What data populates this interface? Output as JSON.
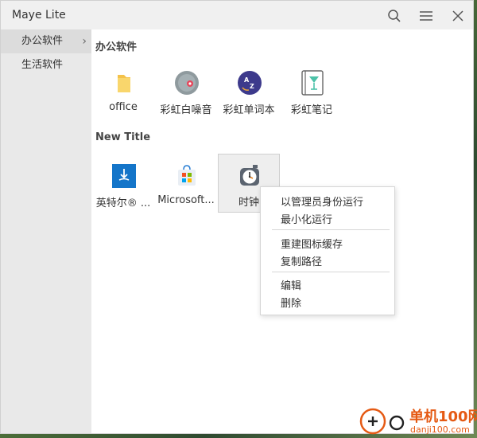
{
  "window": {
    "title": "Maye Lite"
  },
  "sidebar": {
    "items": [
      {
        "label": "办公软件",
        "active": true
      },
      {
        "label": "生活软件",
        "active": false
      }
    ]
  },
  "groups": [
    {
      "title": "办公软件",
      "apps": [
        {
          "label": "office",
          "icon": "folder-icon"
        },
        {
          "label": "彩虹白噪音",
          "icon": "white-noise-icon"
        },
        {
          "label": "彩虹单词本",
          "icon": "word-book-icon"
        },
        {
          "label": "彩虹笔记",
          "icon": "notes-icon"
        }
      ]
    },
    {
      "title": "New Title",
      "apps": [
        {
          "label": "英特尔® ...",
          "icon": "intel-driver-icon"
        },
        {
          "label": "Microsoft...",
          "icon": "microsoft-store-icon"
        },
        {
          "label": "时钟",
          "icon": "clock-icon",
          "selected": true
        }
      ]
    }
  ],
  "context_menu": {
    "items": [
      {
        "label": "以管理员身份运行"
      },
      {
        "label": "最小化运行"
      },
      {
        "label": "重建图标缓存"
      },
      {
        "label": "复制路径"
      },
      {
        "label": "编辑"
      },
      {
        "label": "删除"
      }
    ]
  },
  "watermark": {
    "text1": "单机100网",
    "text2": "danji100.com"
  },
  "colors": {
    "sidebar_bg": "#e9e9e9",
    "titlebar_bg": "#f0f0f0",
    "watermark": "#e55a14"
  }
}
